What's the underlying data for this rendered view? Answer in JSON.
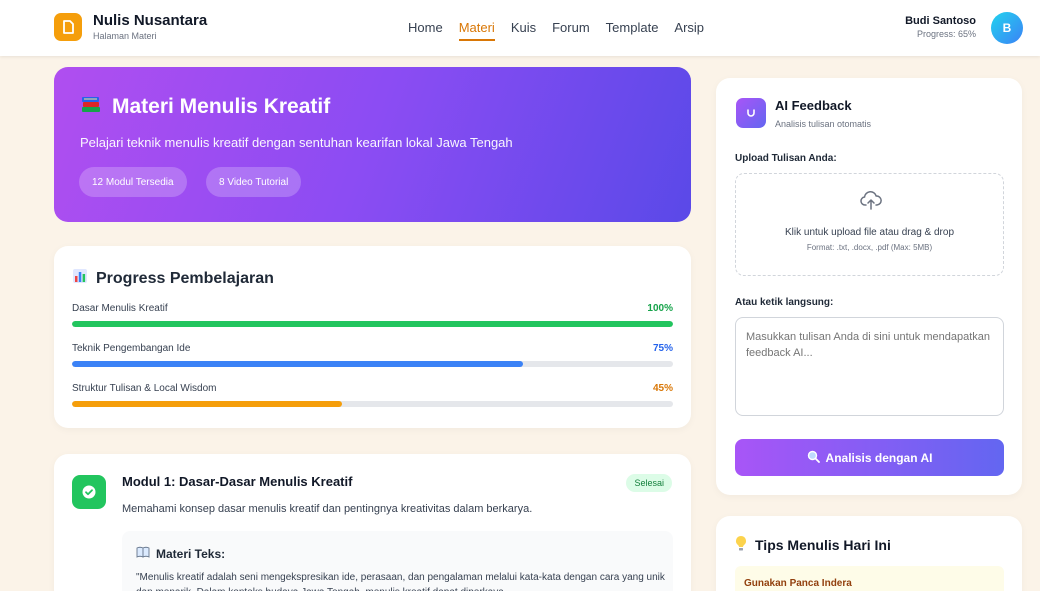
{
  "header": {
    "brand_name": "Nulis Nusantara",
    "brand_sub": "Halaman Materi",
    "nav": [
      "Home",
      "Materi",
      "Kuis",
      "Forum",
      "Template",
      "Arsip"
    ],
    "active_nav": "Materi",
    "user_name": "Budi Santoso",
    "user_progress": "Progress: 65%",
    "avatar_initial": "B"
  },
  "hero": {
    "icon": "books-icon",
    "title": "Materi Menulis Kreatif",
    "description": "Pelajari teknik menulis kreatif dengan sentuhan kearifan lokal Jawa Tengah",
    "pill_modules": "12 Modul Tersedia",
    "pill_videos": "8 Video Tutorial"
  },
  "progress": {
    "title": "Progress Pembelajaran",
    "items": [
      {
        "label": "Dasar Menulis Kreatif",
        "percent_text": "100%",
        "value": 100,
        "color": "#22c55e"
      },
      {
        "label": "Teknik Pengembangan Ide",
        "percent_text": "75%",
        "value": 75,
        "color": "#3b82f6"
      },
      {
        "label": "Struktur Tulisan & Local Wisdom",
        "percent_text": "45%",
        "value": 45,
        "color": "#f59e0b"
      }
    ]
  },
  "module": {
    "title": "Modul 1: Dasar-Dasar Menulis Kreatif",
    "badge": "Selesai",
    "description": "Memahami konsep dasar menulis kreatif dan pentingnya kreativitas dalam berkarya.",
    "text_title": "Materi Teks:",
    "text_body": "\"Menulis kreatif adalah seni mengekspresikan ide, perasaan, dan pengalaman melalui kata-kata dengan cara yang unik dan menarik. Dalam konteks budaya Jawa Tengah, menulis kreatif dapat diperkaya"
  },
  "ai_feedback": {
    "title": "AI Feedback",
    "subtitle": "Analisis tulisan otomatis",
    "upload_label": "Upload Tulisan Anda:",
    "dropzone_text": "Klik untuk upload file atau drag & drop",
    "dropzone_format": "Format: .txt, .docx, .pdf (Max: 5MB)",
    "type_label": "Atau ketik langsung:",
    "textarea_placeholder": "Masukkan tulisan Anda di sini untuk mendapatkan feedback AI...",
    "button_label": "Analisis dengan AI"
  },
  "tips": {
    "title": "Tips Menulis Hari Ini",
    "item_title": "Gunakan Panca Indera"
  },
  "colors": {
    "accent": "#d97706",
    "hero_start": "#b04ef0",
    "hero_end": "#5a49e8",
    "ai_gradient_start": "#a855f7",
    "ai_gradient_end": "#6366f1"
  }
}
